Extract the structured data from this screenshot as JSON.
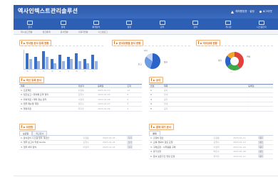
{
  "header": {
    "title": "엑사인텍스트관리솔루션",
    "utils": [
      "해피원방문 · 설정",
      "로그아웃"
    ]
  },
  "nav": {
    "items": [
      {
        "label": "문서",
        "icon": "document-icon"
      },
      {
        "label": "결재",
        "icon": "approval-icon"
      },
      {
        "label": "통계분석",
        "icon": "chart-icon"
      },
      {
        "label": "설정",
        "icon": "settings-icon"
      },
      {
        "label": "관리",
        "icon": "admin-icon"
      },
      {
        "label": "검색",
        "icon": "search-icon"
      },
      {
        "label": "게시판",
        "icon": "board-icon"
      },
      {
        "label": "시스템관리",
        "icon": "system-icon"
      }
    ]
  },
  "subnav": [
    "대시보드현황",
    "월간통계",
    "문서현황",
    "사용자현황",
    "시스템로그"
  ],
  "panels": {
    "bar_title": "▶ 부서별 문서 등록 현황",
    "pie_title": "▶ 문서유형별 문서 현황",
    "donut_title": "▶ 처리상태 현황",
    "list1_title": "▶ 최신 등록 문서",
    "list2_title": "▶ 공지",
    "list3_title": "▶ 보관함",
    "list4_title": "▶ 결재 대기 문서"
  },
  "chart_data": [
    {
      "type": "bar",
      "categories": [
        "A",
        "B",
        "C",
        "D",
        "E",
        "F",
        "G",
        "H",
        "I"
      ],
      "series": [
        {
          "values": [
            8,
            6,
            9,
            5,
            7,
            6,
            8,
            5,
            7
          ]
        },
        {
          "values": [
            5,
            4,
            6,
            3,
            4,
            5,
            4,
            3,
            4
          ]
        }
      ],
      "ylim": [
        0,
        10
      ]
    },
    {
      "type": "pie",
      "categories": [
        "일반",
        "보고",
        "기타"
      ],
      "values": [
        55,
        30,
        15
      ],
      "colors": [
        "#2b63c8",
        "#6f9be2",
        "#c7d7f3"
      ]
    },
    {
      "type": "pie",
      "categories": [
        "완료",
        "진행",
        "대기",
        "반려"
      ],
      "values": [
        40,
        25,
        20,
        15
      ],
      "colors": [
        "#e0413b",
        "#3fa64a",
        "#2b63c8",
        "#f0a530"
      ]
    }
  ],
  "list1": {
    "headers": [
      "제목",
      "작성자",
      "등록일",
      "조회"
    ],
    "rows": [
      [
        "1. 프로젝트",
        "홍길동",
        "2023-01-10",
        "12"
      ],
      [
        "2. 월간보고 / 회의록 요약 정리",
        "김철수",
        "2023-01-09",
        "8"
      ],
      [
        "3. 회의자료 / 계약 정보 관리",
        "이영희",
        "2023-01-08",
        "5"
      ],
      [
        "4. 업무 매뉴얼 개정",
        "박민수",
        "2023-01-07",
        "3"
      ],
      [
        "5. 행정지침",
        "최지우",
        "2023-01-06",
        "2"
      ]
    ]
  },
  "list2": {
    "headers": [
      "번호",
      "제목",
      "등록일"
    ],
    "rows": [
      [
        "1",
        "공지",
        "-"
      ],
      [
        "2",
        "안내",
        "-"
      ],
      [
        "3",
        "공지",
        "-"
      ],
      [
        "4",
        "안내",
        "-"
      ],
      [
        "5",
        "공지",
        "-"
      ]
    ]
  },
  "list3": {
    "tabs": [
      "보관함",
      "최근문서"
    ],
    "rows": [
      [
        "1. 문서관리 시스템 업무 개선안",
        "홍길동",
        "2023-01-05",
        "보기"
      ],
      [
        "2. 업무 보고서 작성 Guide",
        "김철수",
        "2023-01-04",
        "보기"
      ],
      [
        "3. 업무 처리 양식",
        "이영희",
        "2023-01-03",
        "보기"
      ]
    ]
  },
  "list4": {
    "tabs": [
      "결재"
    ],
    "rows": [
      [
        "1. 출장비 정산",
        "홍길동",
        "2023-01-11",
        "대기"
      ],
      [
        "2. 교육 계획서 검토 요청",
        "김철수",
        "2023-01-10",
        "대기"
      ],
      [
        "3. 구매요청 - 사무용품 구매",
        "이영희",
        "2023-01-09",
        "대기"
      ],
      [
        "4. 휴가신청",
        "박민수",
        "2023-01-08",
        "대기"
      ],
      [
        "5. 문서 보존기간 연장 요청",
        "최지우",
        "2023-01-07",
        "대기"
      ]
    ]
  }
}
